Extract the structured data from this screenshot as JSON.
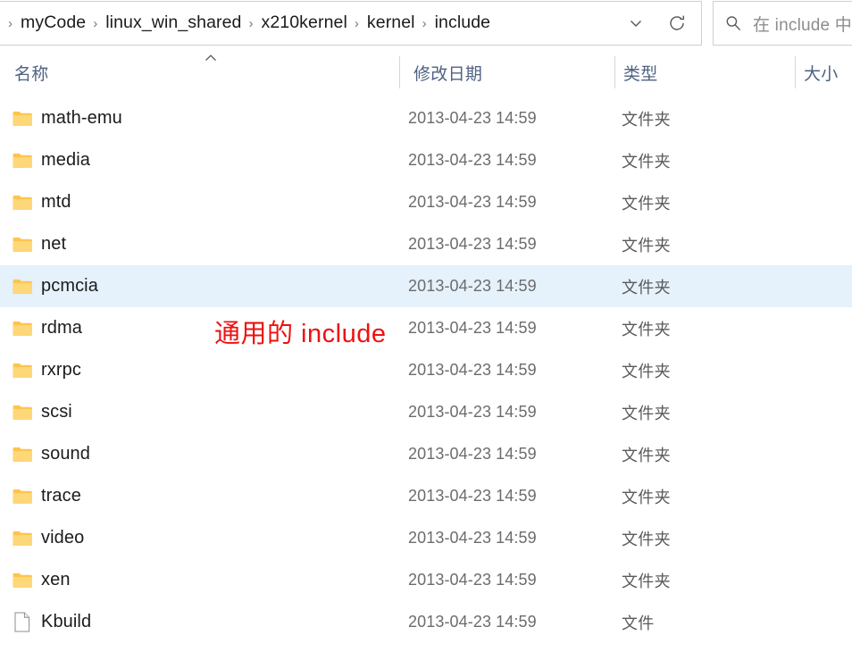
{
  "colors": {
    "annotation_red": "#ee1111",
    "selection_blue": "#e5f1fb",
    "header_text_blue": "#4e6283",
    "folder_yellow": "#ffc95b",
    "border_gray": "#cfcfcf"
  },
  "addressbar": {
    "leading_separator": "›",
    "crumbs": [
      "myCode",
      "linux_win_shared",
      "x210kernel",
      "kernel",
      "include"
    ],
    "separator": "›",
    "dropdown_icon": "chevron-down-icon",
    "refresh_icon": "refresh-icon"
  },
  "search": {
    "icon": "search-icon",
    "placeholder": "在 include 中"
  },
  "columns": {
    "headers": [
      "名称",
      "修改日期",
      "类型",
      "大小"
    ],
    "sort": {
      "column": "名称",
      "direction": "ascending",
      "icon": "caret-up-icon"
    }
  },
  "annotation": {
    "text": "通用的 include"
  },
  "files": [
    {
      "name": "math-emu",
      "date": "2013-04-23 14:59",
      "type": "文件夹",
      "size": "",
      "icon": "folder-icon",
      "selected": false
    },
    {
      "name": "media",
      "date": "2013-04-23 14:59",
      "type": "文件夹",
      "size": "",
      "icon": "folder-icon",
      "selected": false
    },
    {
      "name": "mtd",
      "date": "2013-04-23 14:59",
      "type": "文件夹",
      "size": "",
      "icon": "folder-icon",
      "selected": false
    },
    {
      "name": "net",
      "date": "2013-04-23 14:59",
      "type": "文件夹",
      "size": "",
      "icon": "folder-icon",
      "selected": false
    },
    {
      "name": "pcmcia",
      "date": "2013-04-23 14:59",
      "type": "文件夹",
      "size": "",
      "icon": "folder-icon",
      "selected": true
    },
    {
      "name": "rdma",
      "date": "2013-04-23 14:59",
      "type": "文件夹",
      "size": "",
      "icon": "folder-icon",
      "selected": false
    },
    {
      "name": "rxrpc",
      "date": "2013-04-23 14:59",
      "type": "文件夹",
      "size": "",
      "icon": "folder-icon",
      "selected": false
    },
    {
      "name": "scsi",
      "date": "2013-04-23 14:59",
      "type": "文件夹",
      "size": "",
      "icon": "folder-icon",
      "selected": false
    },
    {
      "name": "sound",
      "date": "2013-04-23 14:59",
      "type": "文件夹",
      "size": "",
      "icon": "folder-icon",
      "selected": false
    },
    {
      "name": "trace",
      "date": "2013-04-23 14:59",
      "type": "文件夹",
      "size": "",
      "icon": "folder-icon",
      "selected": false
    },
    {
      "name": "video",
      "date": "2013-04-23 14:59",
      "type": "文件夹",
      "size": "",
      "icon": "folder-icon",
      "selected": false
    },
    {
      "name": "xen",
      "date": "2013-04-23 14:59",
      "type": "文件夹",
      "size": "",
      "icon": "folder-icon",
      "selected": false
    },
    {
      "name": "Kbuild",
      "date": "2013-04-23 14:59",
      "type": "文件",
      "size": "",
      "icon": "file-icon",
      "selected": false
    }
  ]
}
